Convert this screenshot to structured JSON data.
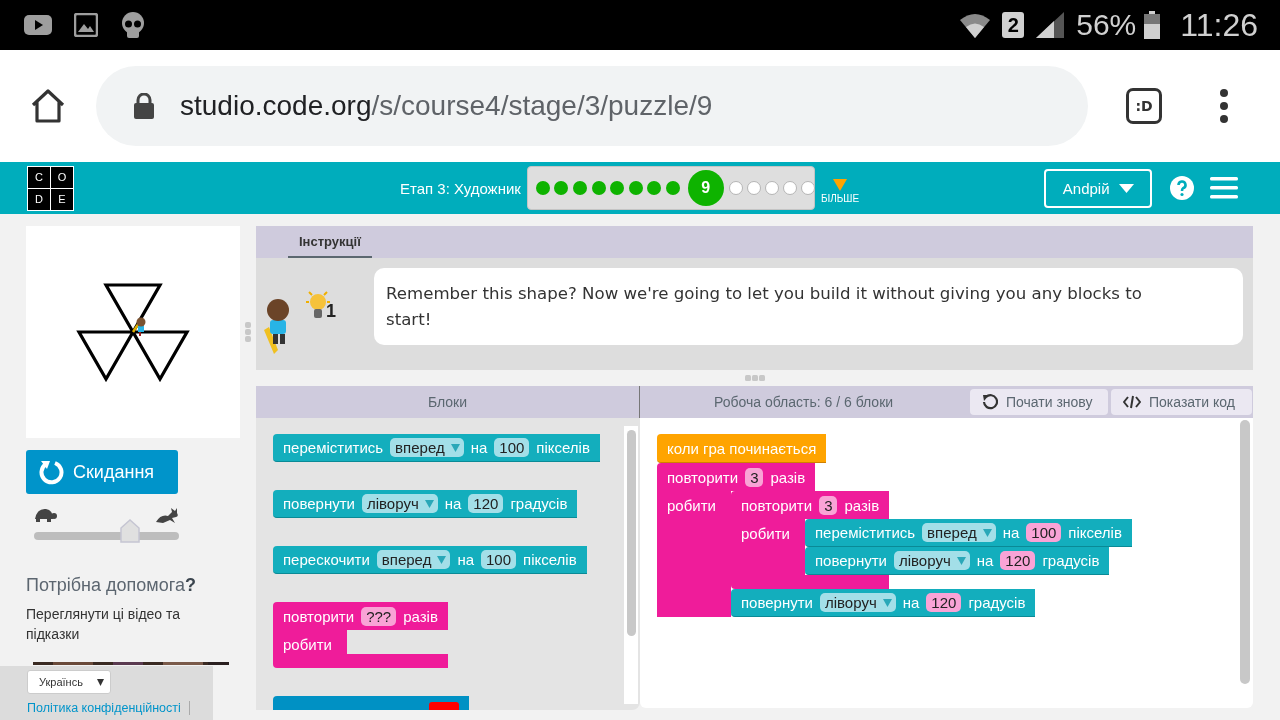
{
  "status_bar": {
    "sim": "2",
    "battery": "56%",
    "time": "11:26"
  },
  "browser": {
    "url_host": "studio.code.org",
    "url_path": "/s/course4/stage/3/puzzle/9",
    "tabs_label": ":D"
  },
  "header": {
    "logo": [
      "C",
      "O",
      "D",
      "E"
    ],
    "stage": "Етап 3: Художник",
    "more": "БІЛЬШЕ",
    "user": "Andрій",
    "levels": [
      {
        "kind": "done"
      },
      {
        "kind": "done"
      },
      {
        "kind": "done"
      },
      {
        "kind": "done"
      },
      {
        "kind": "done"
      },
      {
        "kind": "done"
      },
      {
        "kind": "done"
      },
      {
        "kind": "done"
      },
      {
        "kind": "current",
        "label": "9"
      },
      {
        "kind": "todo"
      },
      {
        "kind": "todo"
      },
      {
        "kind": "todo"
      },
      {
        "kind": "todo"
      },
      {
        "kind": "todo"
      }
    ]
  },
  "left": {
    "reset": "Скидання",
    "speed": {
      "level": 0.66
    },
    "help_title": "Потрібна допомога**?**",
    "help_text": "Переглянути ці відео та підказки",
    "language": "Українсь",
    "privacy_link": "Політика конфіденційності"
  },
  "instructions": {
    "tabs": [
      {
        "label": "Інструкції",
        "selected": true
      }
    ],
    "hint_count": "1",
    "text": "Remember this shape? Now we're going to let you build it without giving you any blocks to start!"
  },
  "toolbox": {
    "title": "Блоки",
    "blocks": [
      {
        "kind": "motion",
        "parts": [
          {
            "kind": "text",
            "text": "переміститись"
          },
          {
            "kind": "dropdown",
            "text": "вперед"
          },
          {
            "kind": "text",
            "text": "на"
          },
          {
            "kind": "number",
            "text": "100"
          },
          {
            "kind": "text",
            "text": "пікселів"
          }
        ]
      },
      {
        "kind": "motion",
        "parts": [
          {
            "kind": "text",
            "text": "повернути"
          },
          {
            "kind": "dropdown",
            "text": "ліворуч"
          },
          {
            "kind": "text",
            "text": "на"
          },
          {
            "kind": "number",
            "text": "120"
          },
          {
            "kind": "text",
            "text": "градусів"
          }
        ]
      },
      {
        "kind": "motion",
        "parts": [
          {
            "kind": "text",
            "text": "перескочити"
          },
          {
            "kind": "dropdown",
            "text": "вперед"
          },
          {
            "kind": "text",
            "text": "на"
          },
          {
            "kind": "number",
            "text": "100"
          },
          {
            "kind": "text",
            "text": "пікселів"
          }
        ]
      },
      {
        "kind": "repeat",
        "parts": [
          {
            "kind": "text",
            "text": "повторити"
          },
          {
            "kind": "number",
            "text": "???"
          },
          {
            "kind": "text",
            "text": "разів"
          }
        ],
        "do_label": "робити"
      },
      {
        "kind": "color"
      }
    ]
  },
  "workspace": {
    "title": "Робоча область: 6 / 6 блоки",
    "buttons": [
      {
        "kind": "restart",
        "label": "Почати знову"
      },
      {
        "kind": "code",
        "label": "Показати код"
      }
    ],
    "blocks": [
      {
        "kind": "event",
        "parts": [
          {
            "kind": "text",
            "text": "коли гра починається"
          }
        ]
      },
      {
        "kind": "repeat",
        "parts": [
          {
            "kind": "text",
            "text": "повторити"
          },
          {
            "kind": "number",
            "text": "3"
          },
          {
            "kind": "text",
            "text": "разів"
          }
        ],
        "do_label": "робити",
        "children": [
          {
            "kind": "repeat",
            "parts": [
              {
                "kind": "text",
                "text": "повторити"
              },
              {
                "kind": "number",
                "text": "3"
              },
              {
                "kind": "text",
                "text": "разів"
              }
            ],
            "do_label": "робити",
            "children": [
              {
                "kind": "motion",
                "parts": [
                  {
                    "kind": "text",
                    "text": "переміститись"
                  },
                  {
                    "kind": "dropdown",
                    "text": "вперед"
                  },
                  {
                    "kind": "text",
                    "text": "на"
                  },
                  {
                    "kind": "number",
                    "text": "100"
                  },
                  {
                    "kind": "text",
                    "text": "пікселів"
                  }
                ]
              },
              {
                "kind": "motion",
                "parts": [
                  {
                    "kind": "text",
                    "text": "повернути"
                  },
                  {
                    "kind": "dropdown",
                    "text": "ліворуч"
                  },
                  {
                    "kind": "text",
                    "text": "на"
                  },
                  {
                    "kind": "number",
                    "text": "120"
                  },
                  {
                    "kind": "text",
                    "text": "градусів"
                  }
                ]
              }
            ]
          },
          {
            "kind": "motion",
            "parts": [
              {
                "kind": "text",
                "text": "повернути"
              },
              {
                "kind": "dropdown",
                "text": "ліворуч"
              },
              {
                "kind": "text",
                "text": "на"
              },
              {
                "kind": "number",
                "text": "120"
              },
              {
                "kind": "text",
                "text": "градусів"
              }
            ]
          }
        ]
      }
    ]
  }
}
